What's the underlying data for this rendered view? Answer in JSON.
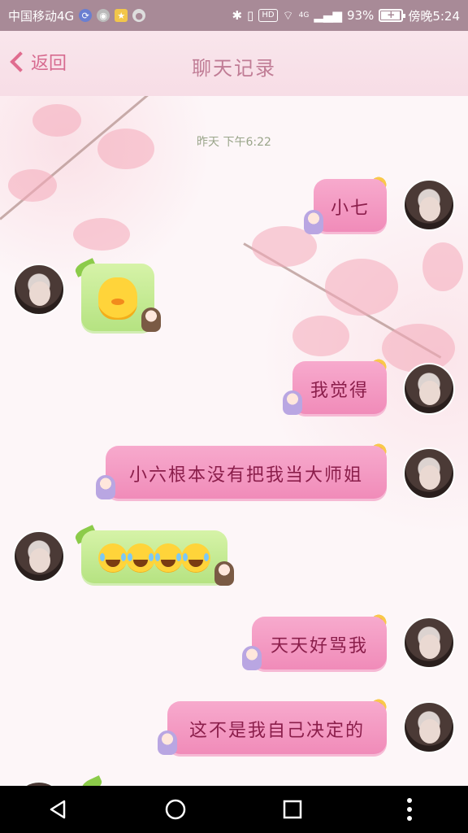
{
  "status_bar": {
    "carrier": "中国移动4G",
    "battery_percent": "93%",
    "time": "傍晚5:24",
    "battery_level": 0.93,
    "icons": [
      "sync-icon",
      "shield-icon",
      "star-app-icon",
      "message-icon",
      "bluetooth-icon",
      "vibrate-icon",
      "hd-icon",
      "wifi-icon",
      "signal-icon",
      "battery-icon"
    ],
    "hd_label": "HD",
    "net_label": "4G"
  },
  "header": {
    "back_label": "返回",
    "title": "聊天记录"
  },
  "chat": {
    "timestamp": "昨天 下午6:22",
    "messages": [
      {
        "side": "right",
        "type": "text",
        "text": "小七"
      },
      {
        "side": "left",
        "type": "sticker",
        "sticker": "duck-emoji"
      },
      {
        "side": "right",
        "type": "text",
        "text": "我觉得"
      },
      {
        "side": "right",
        "type": "text",
        "text": "小六根本没有把我当大师姐"
      },
      {
        "side": "left",
        "type": "emoji",
        "emoji_names": [
          "laughing-crying-emoji",
          "laughing-crying-emoji",
          "laughing-crying-emoji",
          "laughing-crying-emoji"
        ]
      },
      {
        "side": "right",
        "type": "text",
        "text": "天天好骂我"
      },
      {
        "side": "right",
        "type": "text",
        "text": "这不是我自己决定的"
      }
    ]
  },
  "colors": {
    "status_bar": "#a88a97",
    "accent": "#e06c8f",
    "pink_bubble": "#f29ac2",
    "green_bubble": "#c4ea90"
  },
  "nav_bar": {
    "buttons": [
      "back-triangle-icon",
      "home-circle-icon",
      "recent-square-icon",
      "menu-dots-icon"
    ]
  }
}
